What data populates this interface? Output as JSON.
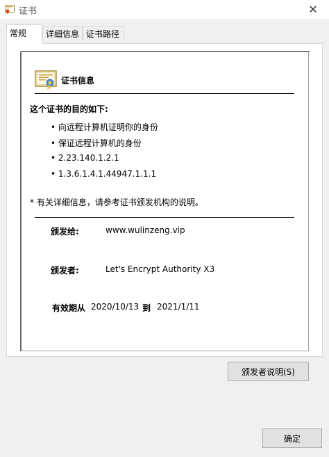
{
  "window": {
    "title": "证书",
    "close_symbol": "✕"
  },
  "tabs": [
    {
      "label": "常规",
      "active": true
    },
    {
      "label": "详细信息",
      "active": false
    },
    {
      "label": "证书路径",
      "active": false
    }
  ],
  "cert": {
    "section_title": "证书信息",
    "purpose_heading": "这个证书的目的如下:",
    "purposes": [
      "• 向远程计算机证明你的身份",
      "• 保证远程计算机的身份",
      "• 2.23.140.1.2.1",
      "• 1.3.6.1.4.1.44947.1.1.1"
    ],
    "note": "* 有关详细信息，请参考证书颁发机构的说明。",
    "issued_to_label": "颁发给:",
    "issued_to_value": "www.wulinzeng.vip",
    "issued_by_label": "颁发者:",
    "issued_by_value": "Let's Encrypt Authority X3",
    "valid_label": "有效期从",
    "valid_from": "2020/10/13",
    "valid_to_label": "到",
    "valid_to": "2021/1/11"
  },
  "buttons": {
    "issuer_statement": "颁发者说明(S)",
    "ok": "确定"
  },
  "colors": {
    "window_bg": "#f0f0f0",
    "panel_bg": "#ffffff",
    "button_bg": "#e1e1e1"
  }
}
